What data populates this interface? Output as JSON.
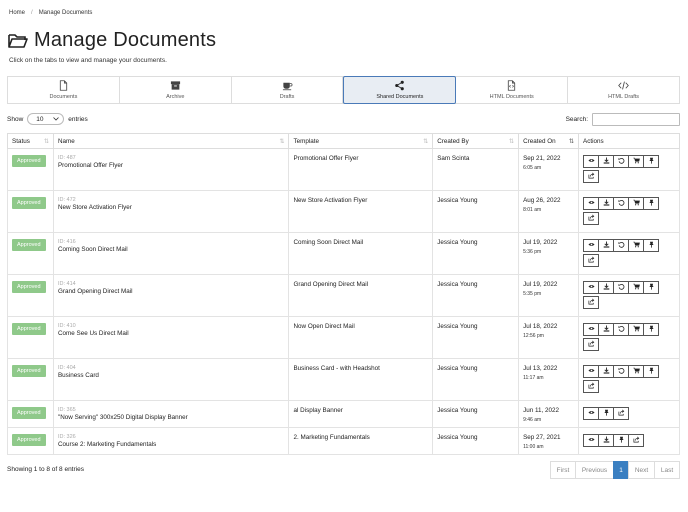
{
  "breadcrumb": {
    "home": "Home",
    "sep": "/",
    "current": "Manage Documents"
  },
  "page": {
    "title": "Manage Documents",
    "subtitle": "Click on the tabs to view and manage your documents."
  },
  "tabs": [
    {
      "label": "Documents",
      "icon": "file-icon"
    },
    {
      "label": "Archive",
      "icon": "archive-icon"
    },
    {
      "label": "Drafts",
      "icon": "coffee-icon"
    },
    {
      "label": "Shared Documents",
      "icon": "share-icon"
    },
    {
      "label": "HTML Documents",
      "icon": "file-code-icon"
    },
    {
      "label": "HTML Drafts",
      "icon": "code-icon"
    }
  ],
  "active_tab": "Shared Documents",
  "controls": {
    "show_label": "Show",
    "page_size": "10",
    "entries_label": "entries",
    "search_label": "Search:",
    "search_value": ""
  },
  "table": {
    "headers": [
      "Status",
      "Name",
      "Template",
      "Created By",
      "Created On",
      "Actions"
    ],
    "rows": [
      {
        "status": "Approved",
        "id": "ID: 487",
        "name": "Promotional Offer Flyer",
        "template": "Promotional Offer Flyer",
        "created_by": "Sam Scinta",
        "date": "Sep 21, 2022",
        "time": "6:05 am"
      },
      {
        "status": "Approved",
        "id": "ID: 472",
        "name": "New Store Activation Flyer",
        "template": "New Store Activation Flyer",
        "created_by": "Jessica Young",
        "date": "Aug 26, 2022",
        "time": "8:01 am"
      },
      {
        "status": "Approved",
        "id": "ID: 416",
        "name": "Coming Soon Direct Mail",
        "template": "Coming Soon Direct Mail",
        "created_by": "Jessica Young",
        "date": "Jul 19, 2022",
        "time": "5:36 pm"
      },
      {
        "status": "Approved",
        "id": "ID: 414",
        "name": "Grand Opening Direct Mail",
        "template": "Grand Opening Direct Mail",
        "created_by": "Jessica Young",
        "date": "Jul 19, 2022",
        "time": "5:35 pm"
      },
      {
        "status": "Approved",
        "id": "ID: 410",
        "name": "Come See Us Direct Mail",
        "template": "Now Open Direct Mail",
        "created_by": "Jessica Young",
        "date": "Jul 18, 2022",
        "time": "12:56 pm"
      },
      {
        "status": "Approved",
        "id": "ID: 404",
        "name": "Business Card",
        "template": "Business Card - with Headshot",
        "created_by": "Jessica Young",
        "date": "Jul 13, 2022",
        "time": "11:17 am"
      },
      {
        "status": "Approved",
        "id": "ID: 365",
        "name": "\"Now Serving\" 300x250 Digital Display Banner",
        "template": "al Display Banner",
        "created_by": "Jessica Young",
        "date": "Jun 11, 2022",
        "time": "9:46 am"
      },
      {
        "status": "Approved",
        "id": "ID: 326",
        "name": "Course 2: Marketing Fundamentals",
        "template": "2. Marketing Fundamentals",
        "created_by": "Jessica Young",
        "date": "Sep 27, 2021",
        "time": "11:00 am"
      }
    ]
  },
  "footer": {
    "info": "Showing 1 to 8 of 8 entries"
  },
  "pagination": [
    "First",
    "Previous",
    "1",
    "Next",
    "Last"
  ],
  "colors": {
    "approved": "#8fc98a",
    "active_page": "#3a7fc1",
    "active_tab_border": "#4a7ab8"
  }
}
